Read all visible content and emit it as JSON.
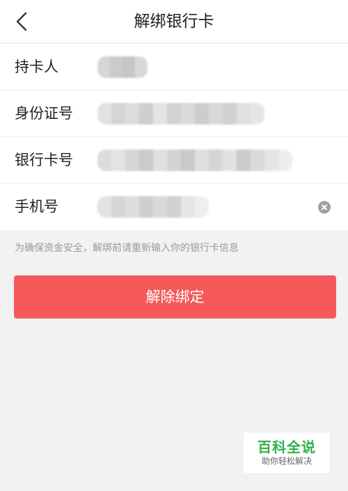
{
  "header": {
    "title": "解绑银行卡",
    "back_icon": "chevron-left-icon"
  },
  "form": {
    "rows": [
      {
        "label": "持卡人"
      },
      {
        "label": "身份证号"
      },
      {
        "label": "银行卡号"
      },
      {
        "label": "手机号",
        "clear_icon": "clear-circle-icon"
      }
    ]
  },
  "notice": "为确保资金安全，解绑前请重新输入你的银行卡信息",
  "unbind_button": {
    "label": "解除绑定",
    "color": "#f5595b"
  },
  "watermark": {
    "title": "百科全说",
    "subtitle": "助你轻松解决"
  }
}
